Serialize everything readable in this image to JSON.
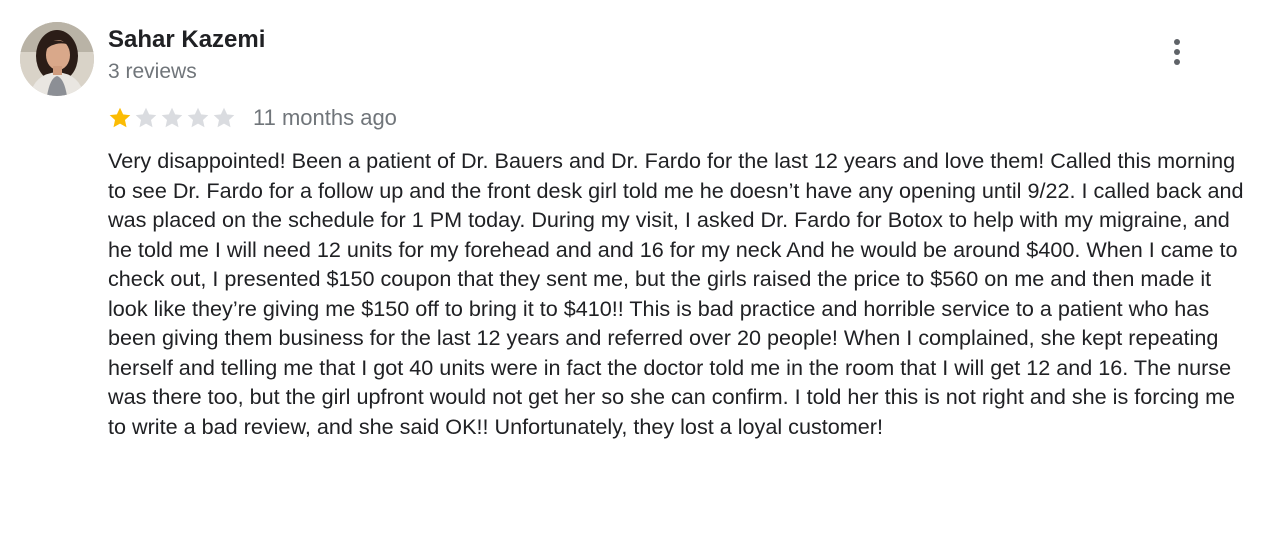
{
  "review": {
    "author_name": "Sahar Kazemi",
    "review_count": "3 reviews",
    "rating": 1,
    "rating_max": 5,
    "date": "11 months ago",
    "text": "Very disappointed! Been a patient of Dr. Bauers and Dr. Fardo for the last 12 years and love them! Called this morning to see Dr. Fardo for a follow up and the front desk girl told me he doesn’t have any opening until 9/22. I called back and was placed on the schedule for 1 PM today. During my visit, I asked Dr. Fardo for Botox to help with my migraine, and he told me I will need 12 units for my forehead and and 16 for my neck And he would be around $400. When I came to check out, I presented $150 coupon that they sent me, but the girls raised the price to $560 on me and then made it look like they’re giving me $150 off to bring it to $410!! This is bad practice and horrible service to a patient who has been giving them business for the last 12 years and referred over 20 people! When I complained, she kept repeating herself and telling me that I got 40 units were in fact the doctor told me in the room that I will get 12 and 16. The nurse was there too, but the girl upfront would not get her so she can confirm. I told her this is not right and she is forcing me to write a bad review, and she said OK!! Unfortunately, they lost a loyal customer!"
  },
  "icons": {
    "more": "more-vert-icon",
    "star": "star-icon"
  },
  "colors": {
    "star_filled": "#fbbc04",
    "star_empty": "#dadce0",
    "secondary_text": "#70757a",
    "primary_text": "#202124"
  }
}
